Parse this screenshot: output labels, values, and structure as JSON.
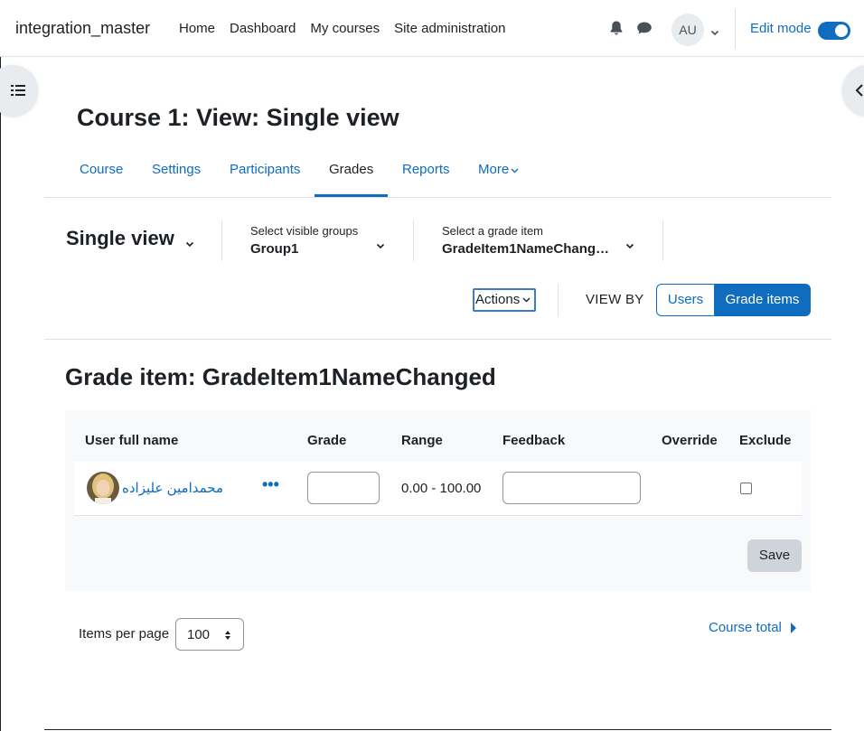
{
  "navbar": {
    "brand": "integration_master",
    "links": [
      "Home",
      "Dashboard",
      "My courses",
      "Site administration"
    ],
    "avatar_initials": "AU",
    "edit_mode_label": "Edit mode",
    "edit_mode_on": true,
    "icons": [
      "bell-icon",
      "chat-icon",
      "chevron-down-icon"
    ]
  },
  "page": {
    "title": "Course 1: View: Single view"
  },
  "secondary_nav": {
    "tabs": [
      "Course",
      "Settings",
      "Participants",
      "Grades",
      "Reports",
      "More"
    ],
    "active": "Grades"
  },
  "tertiary": {
    "report_name": "Single view",
    "groups_label": "Select visible groups",
    "groups_value": "Group1",
    "item_label": "Select a grade item",
    "item_value": "GradeItem1NameChang…",
    "actions_label": "Actions",
    "view_by_label": "VIEW BY",
    "view_by_users": "Users",
    "view_by_items": "Grade items",
    "view_by_selected": "Grade items"
  },
  "grade_item": {
    "heading": "Grade item: GradeItem1NameChanged",
    "columns": {
      "user": "User full name",
      "grade": "Grade",
      "range": "Range",
      "feedback": "Feedback",
      "override": "Override",
      "exclude": "Exclude"
    },
    "rows": [
      {
        "user": "محمدامین علیزاده",
        "actions": "•••",
        "grade": "",
        "range": "0.00 - 100.00",
        "feedback": "",
        "exclude": false
      }
    ],
    "save_label": "Save"
  },
  "pagination": {
    "items_per_page_label": "Items per page",
    "items_per_page_value": "100",
    "course_total_label": "Course total"
  },
  "colors": {
    "accent": "#0f6cbf",
    "text": "#1d2125",
    "panel_bg": "#f8f9fa",
    "save_bg": "#ced4da"
  }
}
